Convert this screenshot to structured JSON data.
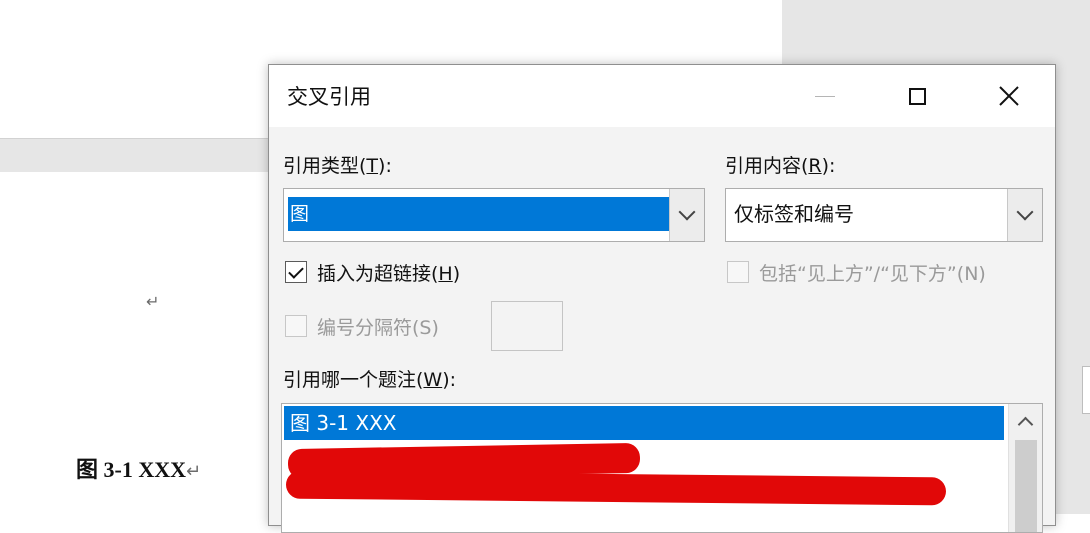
{
  "document": {
    "paragraph_mark": "↵",
    "caption_text": "图  3-1 XXX",
    "caption_mark": "↵"
  },
  "dialog": {
    "title": "交叉引用",
    "ref_type": {
      "label_prefix": "引用类型(",
      "label_key": "T",
      "label_suffix": "):",
      "selected_value": "图"
    },
    "ref_content": {
      "label_prefix": "引用内容(",
      "label_key": "R",
      "label_suffix": "):",
      "selected_value": "仅标签和编号"
    },
    "insert_hyperlink": {
      "label_prefix": "插入为超链接(",
      "label_key": "H",
      "label_suffix": ")",
      "checked": true
    },
    "include_above_below": {
      "label": "包括“见上方”/“见下方”(N)",
      "checked": false,
      "enabled": false
    },
    "number_separator": {
      "label": "编号分隔符(S)",
      "checked": false,
      "enabled": false
    },
    "which_caption": {
      "label_prefix": "引用哪一个题注(",
      "label_key": "W",
      "label_suffix": "):",
      "items": [
        "图 3-1 XXX"
      ]
    }
  },
  "colors": {
    "selection": "#0078d7",
    "redaction": "#e10808",
    "dialog_bg": "#f3f3f3"
  }
}
